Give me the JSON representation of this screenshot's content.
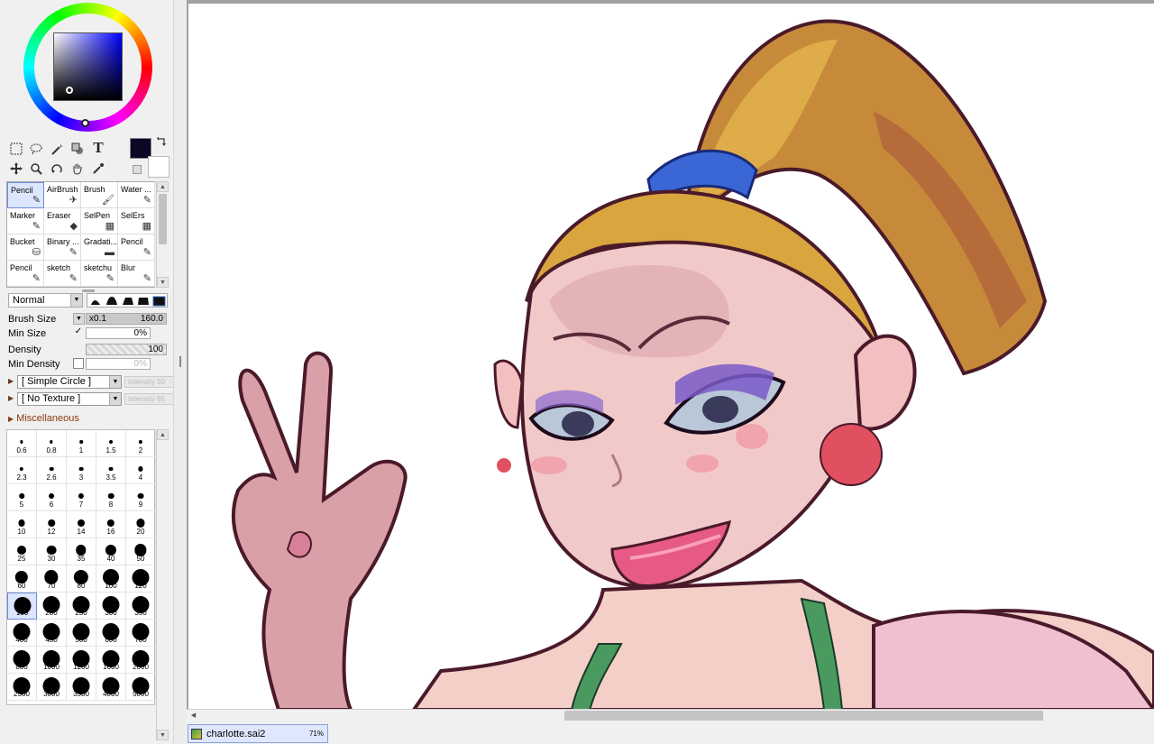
{
  "colors": {
    "accent": "#6c8bd8",
    "foreground_color": "#0a0824",
    "background_color": "#ffffff"
  },
  "toolbar": {
    "tools": [
      "rect-select-icon",
      "lasso-icon",
      "magic-wand-icon",
      "fill-shape-icon",
      "text-icon",
      "move-icon",
      "zoom-icon",
      "rotate-icon",
      "hand-icon",
      "eyedropper-icon"
    ],
    "text_tool_glyph": "T"
  },
  "brushes": [
    {
      "label": "Pencil",
      "icon": "pencil-icon"
    },
    {
      "label": "AirBrush",
      "icon": "airbrush-icon"
    },
    {
      "label": "Brush",
      "icon": "brush-icon"
    },
    {
      "label": "Water ...",
      "icon": "water-brush-icon"
    },
    {
      "label": "Marker",
      "icon": "marker-icon"
    },
    {
      "label": "Eraser",
      "icon": "eraser-icon"
    },
    {
      "label": "SelPen",
      "icon": "selpen-icon"
    },
    {
      "label": "SelErs",
      "icon": "selers-icon"
    },
    {
      "label": "Bucket",
      "icon": "bucket-icon"
    },
    {
      "label": "Binary ...",
      "icon": "binary-pen-icon"
    },
    {
      "label": "Gradati...",
      "icon": "gradation-icon"
    },
    {
      "label": "Pencil",
      "icon": "pencil-icon"
    },
    {
      "label": "Pencil",
      "icon": "pencil-icon"
    },
    {
      "label": "sketch",
      "icon": "sketch-icon"
    },
    {
      "label": "sketchu",
      "icon": "sketch-icon"
    },
    {
      "label": "Blur",
      "icon": "blur-icon"
    }
  ],
  "blend_mode": "Normal",
  "brush_shapes": [
    "shape-1",
    "shape-2",
    "shape-3",
    "shape-4",
    "shape-5"
  ],
  "brush_props": {
    "brush_size_label": "Brush Size",
    "brush_size_multiplier": "x0.1",
    "brush_size_value": "160.0",
    "min_size_label": "Min Size",
    "min_size_checked": "✓",
    "min_size_value": "0%",
    "density_label": "Density",
    "density_value": "100",
    "min_density_label": "Min Density",
    "min_density_value": "0%"
  },
  "shape_row": {
    "name": "[ Simple Circle ]",
    "intensity": "Intensity 50"
  },
  "texture_row": {
    "name": "[ No Texture ]",
    "intensity": "Intensity 95"
  },
  "misc_label": "Miscellaneous",
  "dot_sizes": [
    [
      "0.6",
      "0.8",
      "1",
      "1.5",
      "2"
    ],
    [
      "2.3",
      "2.6",
      "3",
      "3.5",
      "4"
    ],
    [
      "5",
      "6",
      "7",
      "8",
      "9"
    ],
    [
      "10",
      "12",
      "14",
      "16",
      "20"
    ],
    [
      "25",
      "30",
      "35",
      "40",
      "50"
    ],
    [
      "60",
      "70",
      "80",
      "100",
      "120"
    ],
    [
      "160",
      "200",
      "250",
      "300",
      "350"
    ],
    [
      "400",
      "450",
      "500",
      "600",
      "700"
    ],
    [
      "800",
      "1000",
      "1200",
      "1600",
      "2000"
    ],
    [
      "2500",
      "3000",
      "3500",
      "4000",
      "5000"
    ]
  ],
  "selected_dot": "160",
  "file_tab": {
    "name": "charlotte.sai2",
    "zoom": "71%"
  }
}
